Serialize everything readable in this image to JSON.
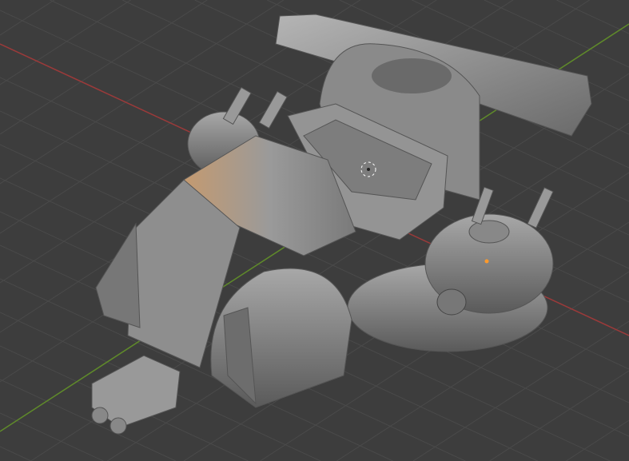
{
  "viewport": {
    "background_color": "#3d3d3d",
    "grid_color": "#4a4a4a",
    "x_axis_color": "#9b3a3a",
    "y_axis_color": "#5f8a2a",
    "model_color": "#8c8c8c",
    "cursor_icon": "3d-cursor-icon"
  }
}
